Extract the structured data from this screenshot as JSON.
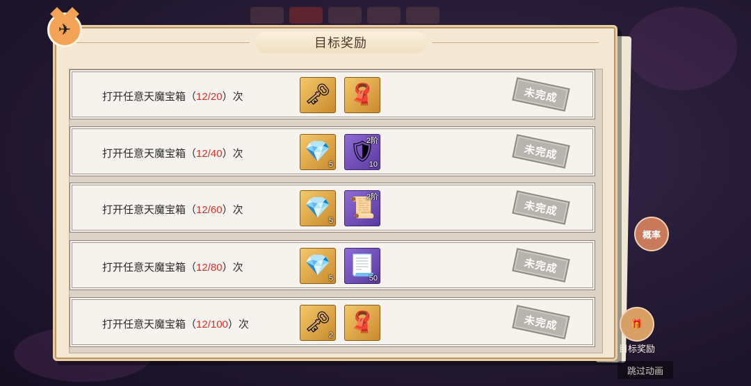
{
  "panel": {
    "title": "目标奖励"
  },
  "rows": [
    {
      "text_prefix": "打开任意天魔宝箱（",
      "progress": "12/20",
      "text_suffix": "）次",
      "rewards": [
        {
          "icon": "golden-key-icon",
          "bg": "gold",
          "count": "",
          "tier": ""
        },
        {
          "icon": "purple-cloth-icon",
          "bg": "gold",
          "count": "",
          "tier": ""
        }
      ],
      "status": "未完成"
    },
    {
      "text_prefix": "打开任意天魔宝箱（",
      "progress": "12/40",
      "text_suffix": "）次",
      "rewards": [
        {
          "icon": "purple-crystal-icon",
          "bg": "gold",
          "count": "5",
          "tier": ""
        },
        {
          "icon": "armor-plate-icon",
          "bg": "purple",
          "count": "10",
          "tier": "2阶"
        }
      ],
      "status": "未完成"
    },
    {
      "text_prefix": "打开任意天魔宝箱（",
      "progress": "12/60",
      "text_suffix": "）次",
      "rewards": [
        {
          "icon": "purple-crystal-icon",
          "bg": "gold",
          "count": "5",
          "tier": ""
        },
        {
          "icon": "green-scroll-icon",
          "bg": "purple",
          "count": "",
          "tier": "2阶"
        }
      ],
      "status": "未完成"
    },
    {
      "text_prefix": "打开任意天魔宝箱（",
      "progress": "12/80",
      "text_suffix": "）次",
      "rewards": [
        {
          "icon": "purple-crystal-icon",
          "bg": "gold",
          "count": "5",
          "tier": ""
        },
        {
          "icon": "talisman-paper-icon",
          "bg": "purple",
          "count": "50",
          "tier": ""
        }
      ],
      "status": "未完成"
    },
    {
      "text_prefix": "打开任意天魔宝箱（",
      "progress": "12/100",
      "text_suffix": "）次",
      "rewards": [
        {
          "icon": "golden-key-icon",
          "bg": "gold",
          "count": "2",
          "tier": ""
        },
        {
          "icon": "purple-cloth-icon",
          "bg": "gold",
          "count": "",
          "tier": ""
        }
      ],
      "status": "未完成"
    }
  ],
  "side": {
    "probability_label": "概率",
    "target_reward_label": "目标奖励",
    "skip_animation_label": "跳过动画"
  },
  "colors": {
    "progress_red": "#d2342e",
    "panel_bg": "#f4e8d4",
    "stamp_gray": "#b7b3ad"
  }
}
